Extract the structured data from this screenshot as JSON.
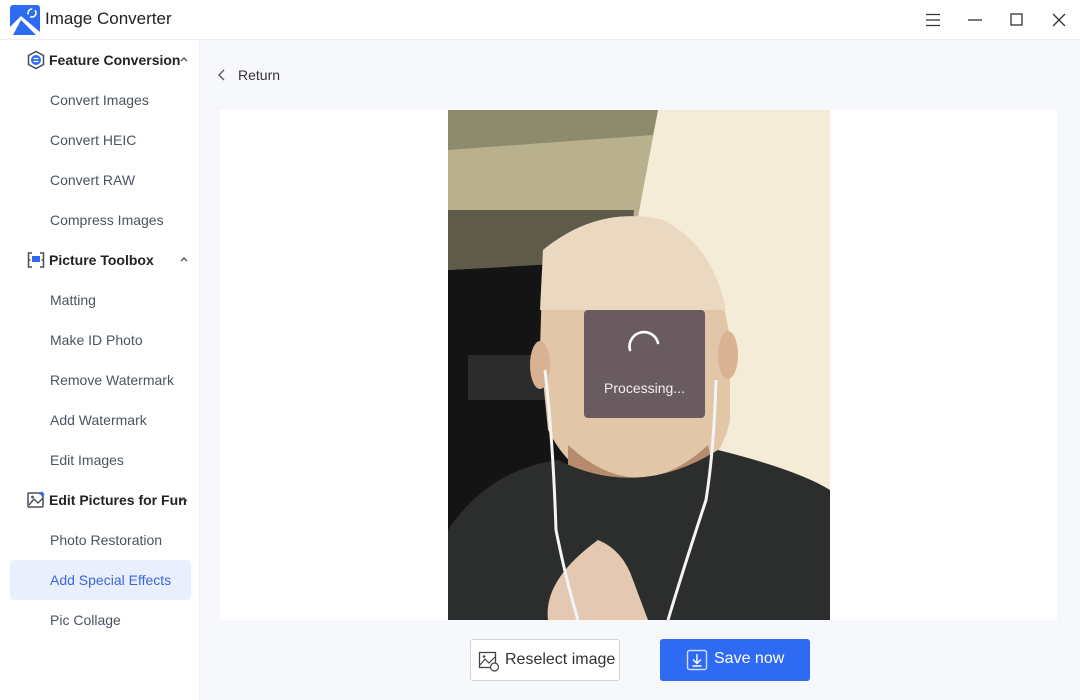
{
  "app": {
    "title": "Image Converter",
    "accent": "#2f6bf2"
  },
  "window_controls": {
    "menu": "menu-icon",
    "minimize": "minimize-icon",
    "maximize": "maximize-icon",
    "close": "close-icon"
  },
  "sidebar": {
    "sections": [
      {
        "label": "Feature Conversion",
        "icon": "convert-icon",
        "expanded": true,
        "items": [
          "Convert Images",
          "Convert HEIC",
          "Convert RAW",
          "Compress Images"
        ]
      },
      {
        "label": "Picture Toolbox",
        "icon": "toolbox-icon",
        "expanded": true,
        "items": [
          "Matting",
          "Make ID Photo",
          "Remove Watermark",
          "Add Watermark",
          "Edit Images"
        ]
      },
      {
        "label": "Edit Pictures for Fun",
        "icon": "fun-picture-icon",
        "expanded": true,
        "items": [
          "Photo Restoration",
          "Add Special Effects",
          "Pic Collage"
        ]
      }
    ],
    "active_item": "Add Special Effects"
  },
  "main": {
    "return_label": "Return",
    "processing_text": "Processing...",
    "reselect_label": "Reselect image",
    "save_label": "Save now"
  }
}
